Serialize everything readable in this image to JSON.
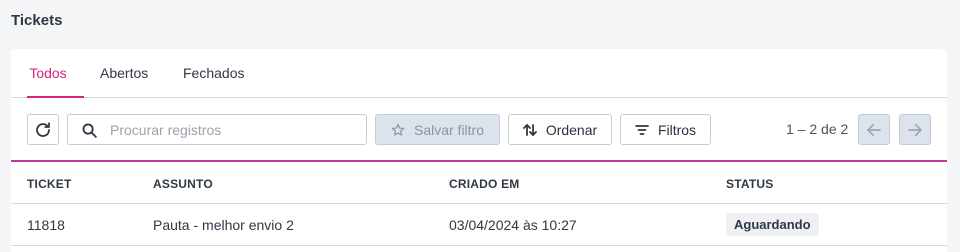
{
  "page": {
    "title": "Tickets"
  },
  "tabs": [
    {
      "label": "Todos",
      "active": true
    },
    {
      "label": "Abertos",
      "active": false
    },
    {
      "label": "Fechados",
      "active": false
    }
  ],
  "toolbar": {
    "refresh_icon": "refresh-icon",
    "search_placeholder": "Procurar registros",
    "search_value": "",
    "save_filter_label": "Salvar filtro",
    "order_label": "Ordenar",
    "filters_label": "Filtros",
    "pagination": "1 – 2 de 2"
  },
  "table": {
    "columns": [
      "TICKET",
      "ASSUNTO",
      "CRIADO EM",
      "STATUS"
    ],
    "rows": [
      {
        "ticket": "11818",
        "assunto": "Pauta - melhor envio 2",
        "criado_em": "03/04/2024 às 10:27",
        "status": "Aguardando"
      }
    ]
  },
  "colors": {
    "accent": "#d6247f",
    "divider": "#b93a95"
  }
}
